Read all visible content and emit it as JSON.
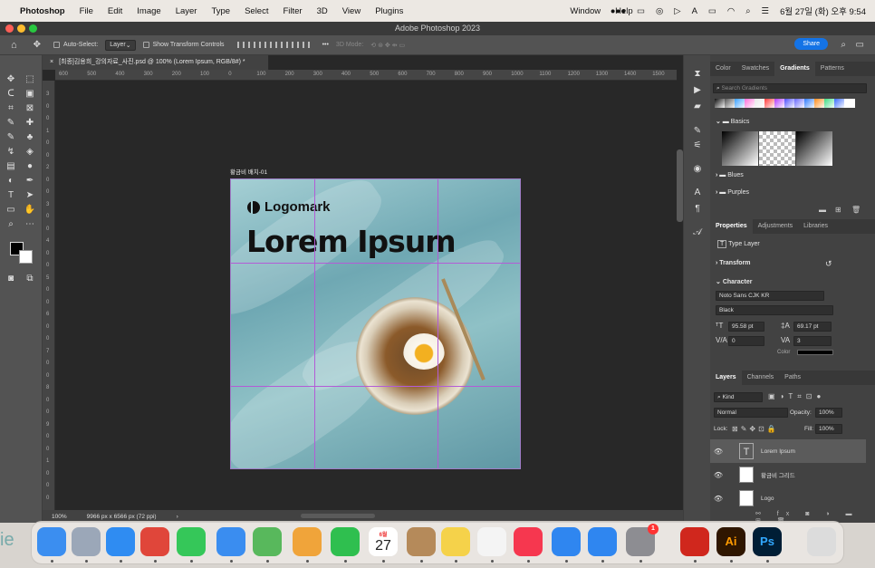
{
  "menubar": {
    "apple": "",
    "app_name": "Photoshop",
    "items": [
      "File",
      "Edit",
      "Image",
      "Layer",
      "Type",
      "Select",
      "Filter",
      "3D",
      "View",
      "Plugins"
    ],
    "right_items": [
      "Window",
      "Help"
    ],
    "datetime": "6월 27일 (화) 오후 9:54"
  },
  "window": {
    "title": "Adobe Photoshop 2023"
  },
  "options_bar": {
    "auto_select_label": "Auto-Select:",
    "auto_select_value": "Layer",
    "show_transform_label": "Show Transform Controls",
    "mode_3d_label": "3D Mode:",
    "share_label": "Share"
  },
  "document": {
    "tab_title": "[최종]김용희_강의자료_사진.psd @ 100% (Lorem Ipsum, RGB/8#) *",
    "artboard_label": "황금비 배치-01",
    "logo_text": "Logomark",
    "headline": "Lorem Ipsum",
    "zoom": "100%",
    "dimensions": "9966 px x 6566 px (72 ppi)"
  },
  "rulers": {
    "top": [
      "600",
      "500",
      "400",
      "300",
      "200",
      "100",
      "0",
      "100",
      "200",
      "300",
      "400",
      "500",
      "600",
      "700",
      "800",
      "900",
      "1000",
      "1100",
      "1200",
      "1300",
      "1400",
      "1500"
    ],
    "left": [
      "3",
      "0",
      "0",
      "1",
      "0",
      "0",
      "2",
      "0",
      "0",
      "3",
      "0",
      "0",
      "4",
      "0",
      "0",
      "5",
      "0",
      "0",
      "6",
      "0",
      "0",
      "7",
      "0",
      "0",
      "8",
      "0",
      "0",
      "9",
      "0",
      "0",
      "1",
      "0",
      "0",
      "0"
    ]
  },
  "gradients_panel": {
    "tabs": [
      "Color",
      "Swatches",
      "Gradients",
      "Patterns"
    ],
    "active_tab": "Gradients",
    "search_placeholder": "Search Gradients",
    "groups": [
      "Basics",
      "Blues",
      "Purples"
    ],
    "swatch_colors": [
      "#111111",
      "#555555",
      "#3aa0ff",
      "#ff6fd8",
      "#e8e8e8",
      "#ff3b3b",
      "#b03bff",
      "#5050ff",
      "#6a6aff",
      "#2e7bff",
      "#ff8c1a",
      "#3ddc84",
      "#3b6bff",
      "#ffffff"
    ]
  },
  "properties_panel": {
    "tabs": [
      "Properties",
      "Adjustments",
      "Libraries"
    ],
    "active_tab": "Properties",
    "layer_type": "Type Layer",
    "transform_label": "Transform",
    "character_label": "Character",
    "font_family": "Noto Sans CJK KR",
    "font_style": "Black",
    "font_size": "95.58 pt",
    "leading": "69.17 pt",
    "kerning": "0",
    "tracking": "3",
    "color_label": "Color"
  },
  "layers_panel": {
    "tabs": [
      "Layers",
      "Channels",
      "Paths"
    ],
    "active_tab": "Layers",
    "kind_label": "Kind",
    "blend_mode": "Normal",
    "opacity_label": "Opacity:",
    "opacity_value": "100%",
    "lock_label": "Lock:",
    "fill_label": "Fill:",
    "fill_value": "100%",
    "layers": [
      {
        "name": "Lorem Ipsum",
        "thumb": "T"
      },
      {
        "name": "황금비 그리드",
        "thumb": ""
      },
      {
        "name": "Logo",
        "thumb": ""
      }
    ]
  },
  "dock": {
    "calendar_month": "6월",
    "calendar_day": "27",
    "settings_badge": "1",
    "apps": [
      {
        "name": "finder",
        "label": "",
        "color": "#3b8ef0"
      },
      {
        "name": "launchpad",
        "label": "",
        "color": "#9ba7b8"
      },
      {
        "name": "safari",
        "label": "",
        "color": "#2f8cf2"
      },
      {
        "name": "chrome",
        "label": "",
        "color": "#e0463a"
      },
      {
        "name": "messages",
        "label": "",
        "color": "#35c759"
      },
      {
        "name": "mail",
        "label": "",
        "color": "#3a8df0"
      },
      {
        "name": "maps",
        "label": "",
        "color": "#58b85c"
      },
      {
        "name": "photos",
        "label": "",
        "color": "#f0a43a"
      },
      {
        "name": "facetime",
        "label": "",
        "color": "#2fbf4f"
      },
      {
        "name": "calendar",
        "label": "",
        "color": "#ffffff"
      },
      {
        "name": "contacts",
        "label": "",
        "color": "#b58a5a"
      },
      {
        "name": "notes",
        "label": "",
        "color": "#f5d24a"
      },
      {
        "name": "freeform",
        "label": "",
        "color": "#f4f4f4"
      },
      {
        "name": "music",
        "label": "",
        "color": "#f6374f"
      },
      {
        "name": "keynote",
        "label": "",
        "color": "#2f86f0"
      },
      {
        "name": "app-store",
        "label": "",
        "color": "#2f86f0"
      },
      {
        "name": "system-settings",
        "label": "",
        "color": "#8d8d92"
      },
      {
        "name": "acrobat",
        "label": "",
        "color": "#d0271d"
      },
      {
        "name": "illustrator",
        "label": "Ai",
        "color": "#2f1600"
      },
      {
        "name": "photoshop",
        "label": "Ps",
        "color": "#001e36"
      },
      {
        "name": "trash",
        "label": "",
        "color": "#dcdcdc"
      }
    ]
  }
}
